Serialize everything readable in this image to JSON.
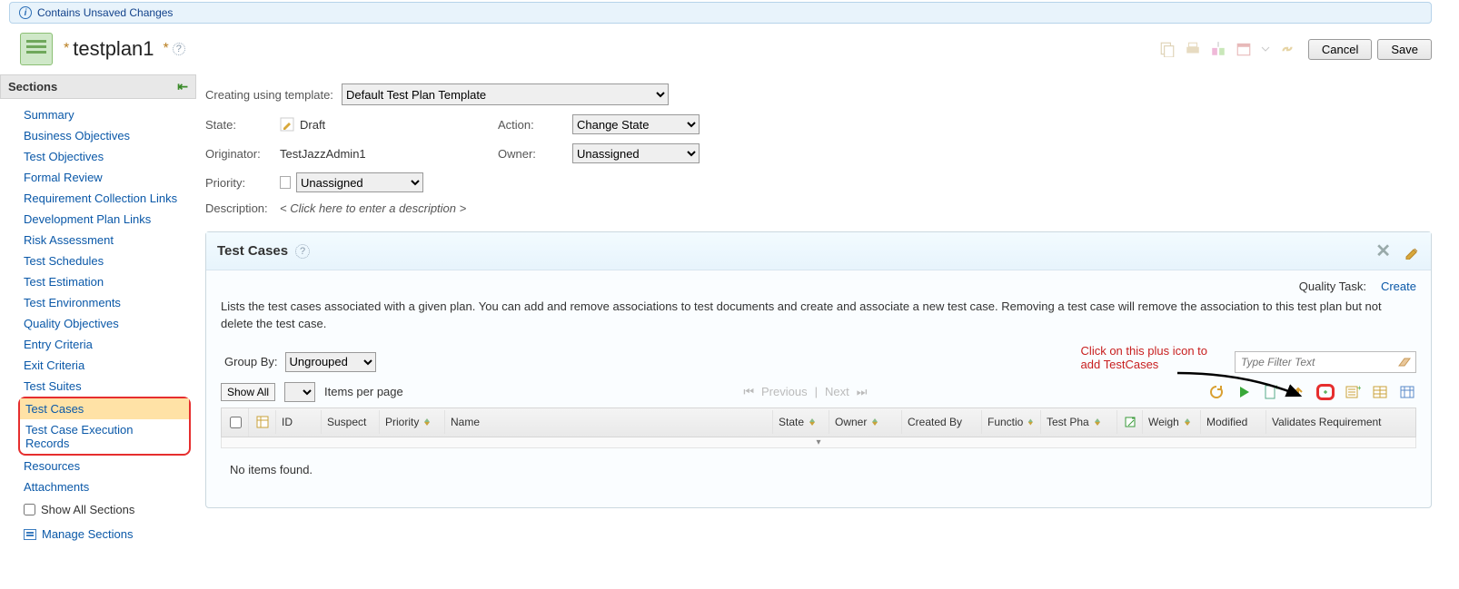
{
  "notification": "Contains Unsaved Changes",
  "plan": {
    "title": "testplan1"
  },
  "buttons": {
    "cancel": "Cancel",
    "save": "Save"
  },
  "sidebar": {
    "title": "Sections",
    "items": [
      "Summary",
      "Business Objectives",
      "Test Objectives",
      "Formal Review",
      "Requirement Collection Links",
      "Development Plan Links",
      "Risk Assessment",
      "Test Schedules",
      "Test Estimation",
      "Test Environments",
      "Quality Objectives",
      "Entry Criteria",
      "Exit Criteria",
      "Test Suites",
      "Test Cases",
      "Test Case Execution Records",
      "Resources",
      "Attachments"
    ],
    "show_all": "Show All Sections",
    "manage": "Manage Sections"
  },
  "form": {
    "template_label": "Creating using template:",
    "template_value": "Default Test Plan Template",
    "state_label": "State:",
    "state_value": "Draft",
    "action_label": "Action:",
    "action_value": "Change State",
    "originator_label": "Originator:",
    "originator_value": "TestJazzAdmin1",
    "owner_label": "Owner:",
    "owner_value": "Unassigned",
    "priority_label": "Priority:",
    "priority_value": "Unassigned",
    "description_label": "Description:",
    "description_placeholder": "< Click here to enter a description >"
  },
  "panel": {
    "title": "Test Cases",
    "quality_task_label": "Quality Task:",
    "create": "Create",
    "description": "Lists the test cases associated with a given plan. You can add and remove associations to test documents and create and associate a new test case. Removing a test case will remove the association to this test plan but not delete the test case.",
    "group_by_label": "Group By:",
    "group_by_value": "Ungrouped",
    "annotation_line1": "Click on this plus icon to",
    "annotation_line2": "add TestCases",
    "filter_placeholder": "Type Filter Text",
    "show_all": "Show All",
    "items_per_page": "Items per page",
    "previous": "Previous",
    "next": "Next",
    "columns": {
      "id": "ID",
      "suspect": "Suspect",
      "priority": "Priority",
      "name": "Name",
      "state": "State",
      "owner": "Owner",
      "created_by": "Created By",
      "functional": "Functio",
      "test_phase": "Test Pha",
      "weight": "Weigh",
      "modified": "Modified",
      "validates": "Validates Requirement"
    },
    "no_items": "No items found."
  }
}
